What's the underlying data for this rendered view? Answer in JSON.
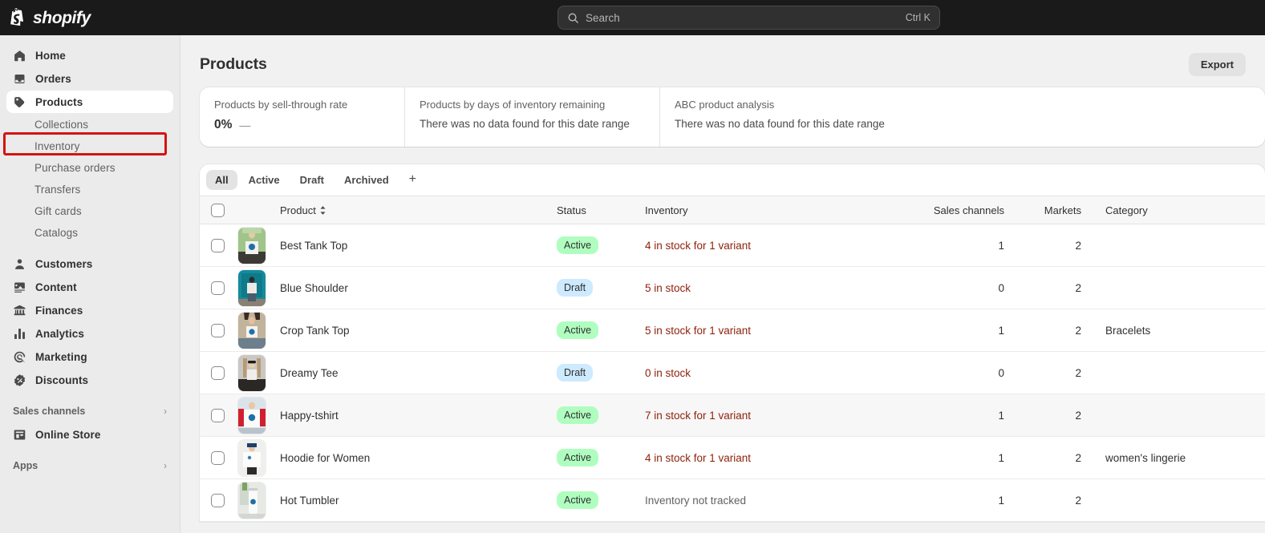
{
  "topbar": {
    "brand_name": "shopify",
    "search": {
      "placeholder": "Search",
      "shortcut": "Ctrl K"
    }
  },
  "sidebar": {
    "items": [
      {
        "label": "Home",
        "icon": "home-icon",
        "type": "main"
      },
      {
        "label": "Orders",
        "icon": "orders-icon",
        "type": "main"
      },
      {
        "label": "Products",
        "icon": "products-tag-icon",
        "type": "main",
        "active": true
      },
      {
        "label": "Collections",
        "type": "sub"
      },
      {
        "label": "Inventory",
        "type": "sub"
      },
      {
        "label": "Purchase orders",
        "type": "sub"
      },
      {
        "label": "Transfers",
        "type": "sub"
      },
      {
        "label": "Gift cards",
        "type": "sub"
      },
      {
        "label": "Catalogs",
        "type": "sub"
      },
      {
        "label": "Customers",
        "icon": "customers-icon",
        "type": "main"
      },
      {
        "label": "Content",
        "icon": "content-icon",
        "type": "main"
      },
      {
        "label": "Finances",
        "icon": "finances-bank-icon",
        "type": "main"
      },
      {
        "label": "Analytics",
        "icon": "analytics-bars-icon",
        "type": "main"
      },
      {
        "label": "Marketing",
        "icon": "marketing-target-icon",
        "type": "main"
      },
      {
        "label": "Discounts",
        "icon": "discounts-badge-icon",
        "type": "main"
      }
    ],
    "sales_channels": {
      "label": "Sales channels",
      "chevron": "›"
    },
    "online_store": {
      "label": "Online Store",
      "icon": "storefront-icon"
    },
    "apps": {
      "label": "Apps",
      "chevron": "›"
    },
    "highlight_color": "#d31510"
  },
  "page": {
    "title": "Products",
    "export_label": "Export"
  },
  "analytics": [
    {
      "label": "Products by sell-through rate",
      "value": "0%",
      "dash": "—",
      "empty": null
    },
    {
      "label": "Products by days of inventory remaining",
      "value": null,
      "dash": null,
      "empty": "There was no data found for this date range"
    },
    {
      "label": "ABC product analysis",
      "value": null,
      "dash": null,
      "empty": "There was no data found for this date range"
    }
  ],
  "tabs": {
    "items": [
      "All",
      "Active",
      "Draft",
      "Archived"
    ],
    "active_index": 0,
    "add_label": "+"
  },
  "table": {
    "headers": {
      "product": "Product",
      "status": "Status",
      "inventory": "Inventory",
      "sales_channels": "Sales channels",
      "markets": "Markets",
      "category": "Category"
    },
    "rows": [
      {
        "name": "Best Tank Top",
        "status": "Active",
        "status_kind": "active",
        "inventory": "4 in stock for 1 variant",
        "inventory_kind": "low",
        "sales_channels": "1",
        "markets": "2",
        "category": "",
        "thumb": "tank-top-photo",
        "hover": false
      },
      {
        "name": "Blue Shoulder",
        "status": "Draft",
        "status_kind": "draft",
        "inventory": "5 in stock",
        "inventory_kind": "low",
        "sales_channels": "0",
        "markets": "2",
        "category": "",
        "thumb": "blue-shoulder-photo",
        "hover": false
      },
      {
        "name": "Crop Tank Top",
        "status": "Active",
        "status_kind": "active",
        "inventory": "5 in stock for 1 variant",
        "inventory_kind": "low",
        "sales_channels": "1",
        "markets": "2",
        "category": "Bracelets",
        "thumb": "crop-tank-photo",
        "hover": false
      },
      {
        "name": "Dreamy Tee",
        "status": "Draft",
        "status_kind": "draft",
        "inventory": "0 in stock",
        "inventory_kind": "low",
        "sales_channels": "0",
        "markets": "2",
        "category": "",
        "thumb": "dreamy-tee-photo",
        "hover": false
      },
      {
        "name": "Happy-tshirt",
        "status": "Active",
        "status_kind": "active",
        "inventory": "7 in stock for 1 variant",
        "inventory_kind": "low",
        "sales_channels": "1",
        "markets": "2",
        "category": "",
        "thumb": "happy-tshirt-photo",
        "hover": true
      },
      {
        "name": "Hoodie for Women",
        "status": "Active",
        "status_kind": "active",
        "inventory": "4 in stock for 1 variant",
        "inventory_kind": "low",
        "sales_channels": "1",
        "markets": "2",
        "category": "women's lingerie",
        "thumb": "hoodie-photo",
        "hover": false
      },
      {
        "name": "Hot Tumbler",
        "status": "Active",
        "status_kind": "active",
        "inventory": "Inventory not tracked",
        "inventory_kind": "none",
        "sales_channels": "1",
        "markets": "2",
        "category": "",
        "thumb": "tumbler-photo",
        "hover": false
      }
    ]
  }
}
